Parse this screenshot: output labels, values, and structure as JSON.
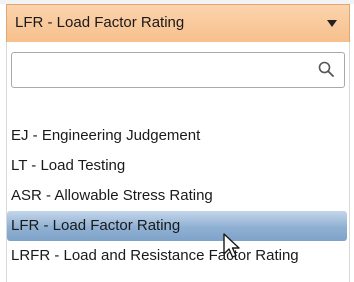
{
  "select": {
    "selected_value": "LFR - Load Factor Rating",
    "arrow_icon": "triangle-down-icon",
    "background_color": "#f7c08d"
  },
  "search": {
    "value": "",
    "placeholder": "",
    "icon": "search-icon"
  },
  "options": [
    {
      "label": "EJ - Engineering Judgement",
      "highlighted": false
    },
    {
      "label": "LT - Load Testing",
      "highlighted": false
    },
    {
      "label": "ASR - Allowable Stress Rating",
      "highlighted": false
    },
    {
      "label": "LFR - Load Factor Rating",
      "highlighted": true
    },
    {
      "label": "LRFR - Load and Resistance Factor Rating",
      "highlighted": false
    }
  ],
  "colors": {
    "highlight": "#8fb0d3",
    "select_border": "#e0a774"
  }
}
